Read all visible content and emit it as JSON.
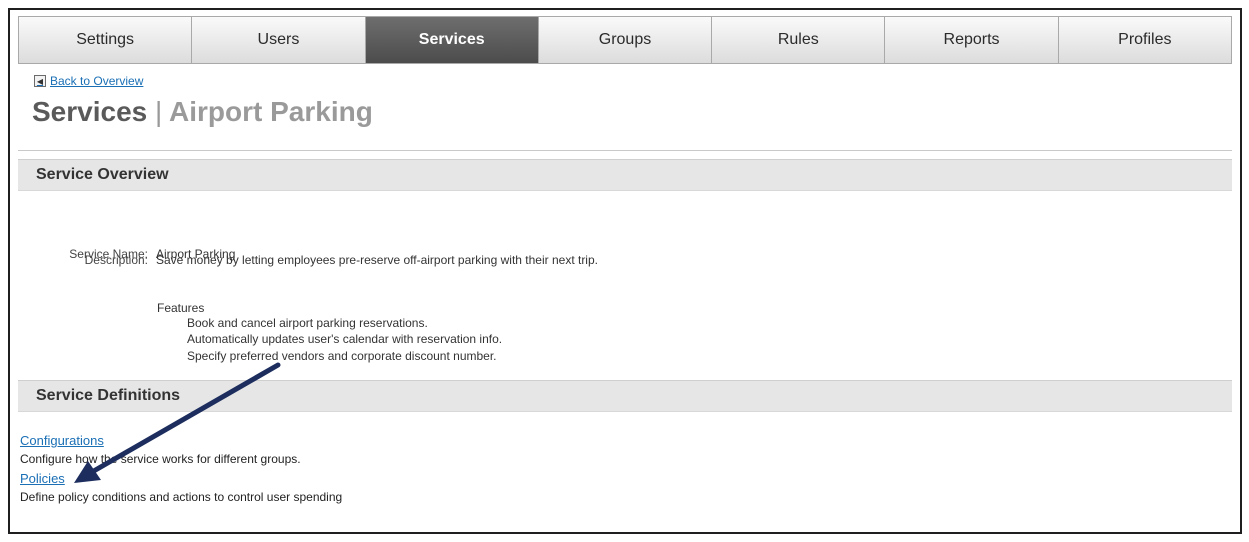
{
  "tabs": [
    {
      "label": "Settings",
      "active": false
    },
    {
      "label": "Users",
      "active": false
    },
    {
      "label": "Services",
      "active": true
    },
    {
      "label": "Groups",
      "active": false
    },
    {
      "label": "Rules",
      "active": false
    },
    {
      "label": "Reports",
      "active": false
    },
    {
      "label": "Profiles",
      "active": false
    }
  ],
  "back_link": {
    "icon": "arrow-left-box-icon",
    "label": "Back to Overview"
  },
  "page_title": {
    "main": "Services",
    "separator": "|",
    "sub": "Airport Parking"
  },
  "overview": {
    "header": "Service Overview",
    "service_name_label": "Service Name:",
    "service_name_value": "Airport Parking",
    "description_label": "Description:",
    "description_value": "Save money by letting employees pre-reserve off-airport parking with their next trip.",
    "features_title": "Features",
    "features": [
      "Book and cancel airport parking reservations.",
      "Automatically updates user's calendar with reservation info.",
      "Specify preferred vendors and corporate discount number."
    ]
  },
  "definitions": {
    "header": "Service Definitions",
    "items": [
      {
        "label": "Configurations",
        "description": "Configure how the service works for different groups."
      },
      {
        "label": "Policies",
        "description": "Define policy conditions and actions to control user spending"
      }
    ]
  },
  "colors": {
    "active_tab": "#5a5a5a",
    "link": "#1a6fb5",
    "annotation_arrow": "#1c2d5e",
    "section_header_bg": "#e6e6e6"
  }
}
